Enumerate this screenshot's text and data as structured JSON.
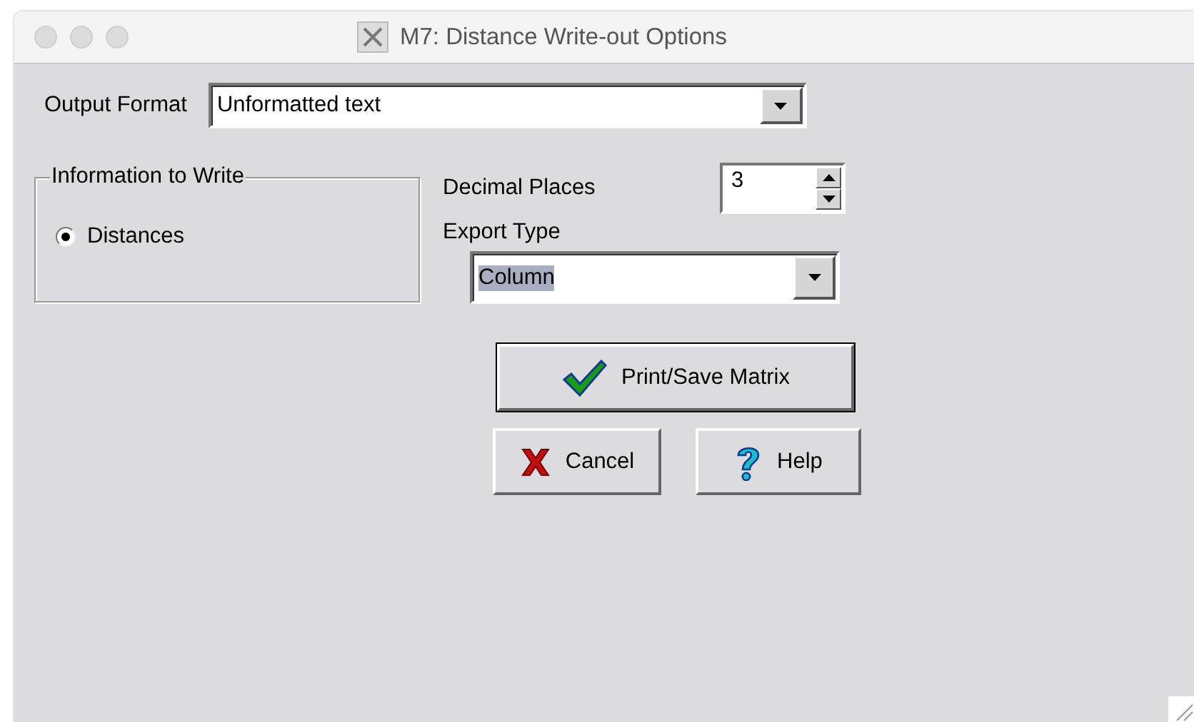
{
  "window": {
    "title": "M7: Distance Write-out Options"
  },
  "output_format": {
    "label": "Output Format",
    "value": "Unformatted text"
  },
  "information_to_write": {
    "title": "Information to Write",
    "options": [
      {
        "label": "Distances",
        "selected": true
      }
    ]
  },
  "decimal_places": {
    "label": "Decimal Places",
    "value": "3"
  },
  "export_type": {
    "label": "Export Type",
    "value": "Column",
    "value_highlighted": true
  },
  "buttons": [
    {
      "kind": "check",
      "label": "Print/Save Matrix",
      "default": true
    },
    {
      "kind": "cross",
      "label": "Cancel",
      "default": false
    },
    {
      "kind": "question",
      "label": "Help",
      "default": false
    }
  ]
}
